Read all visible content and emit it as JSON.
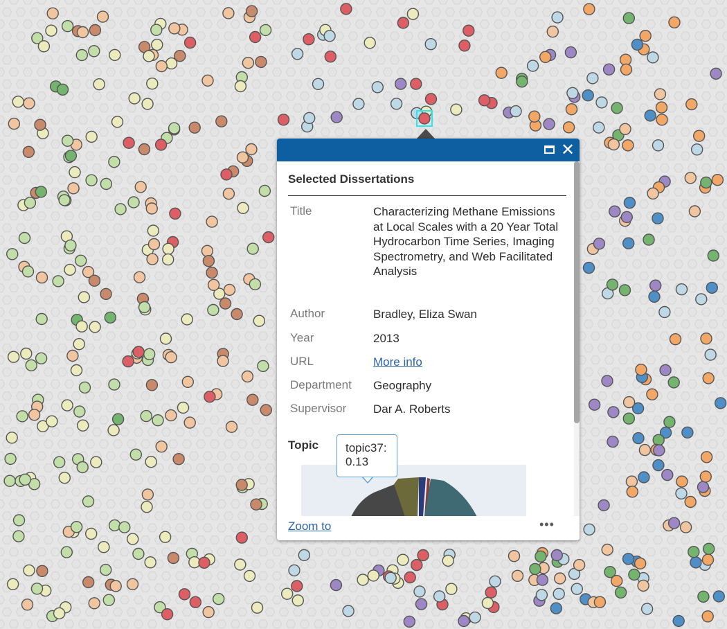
{
  "map": {
    "background": "#e6e6e6",
    "hex_color": "#d4d4d4",
    "point_colors": {
      "yellow": "#ecebbd",
      "lightgreen": "#c3dfa9",
      "green": "#74b46f",
      "blue": "#4e8fc7",
      "lightblue": "#bfd8e6",
      "purple": "#9d87c4",
      "red": "#dd5e64",
      "orange": "#f2a766",
      "tan": "#f1c59f",
      "brown": "#c98a6c"
    }
  },
  "popup": {
    "title": "Selected Dissertations",
    "header_color": "#0e5fa1",
    "maximize_icon": "maximize-icon",
    "close_icon": "close-icon",
    "close_symbol": "✕",
    "attributes": [
      {
        "label": "Title",
        "value": "Characterizing Methane Emissions at Local Scales with a 20 Year Total Hydrocarbon Time Series, Imaging Spectrometry, and Web Facilitated Analysis"
      },
      {
        "label": "Author",
        "value": "Bradley, Eliza Swan"
      },
      {
        "label": "Year",
        "value": "2013"
      },
      {
        "label": "URL",
        "value": "More info"
      },
      {
        "label": "Department",
        "value": "Geography"
      },
      {
        "label": "Supervisor",
        "value": "Dar A. Roberts"
      }
    ],
    "topic_label": "Topic",
    "tooltip": {
      "line1": "topic37:",
      "line2": "0.13"
    },
    "footer": {
      "zoom_label": "Zoom to",
      "more_label": "•••"
    }
  }
}
